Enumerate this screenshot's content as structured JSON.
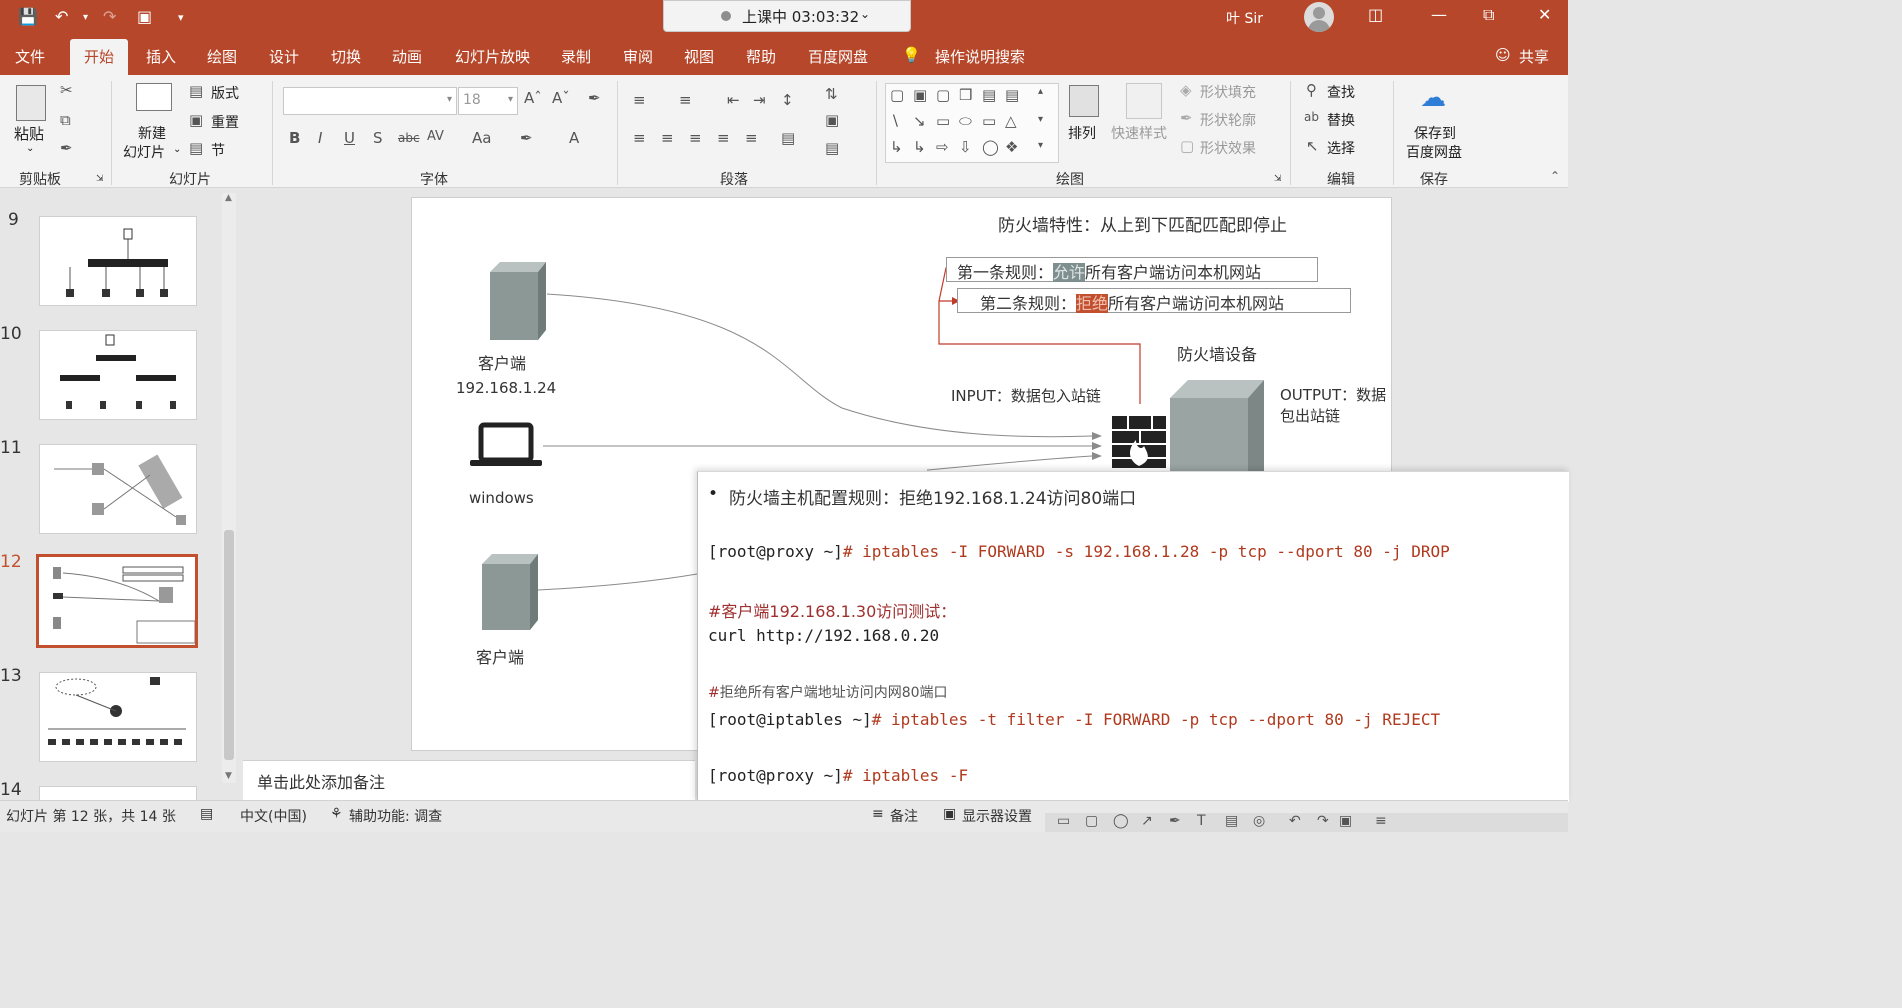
{
  "session": {
    "status": "上课中 03:03:32"
  },
  "user": {
    "name": "叶 Sir"
  },
  "tabs": [
    "文件",
    "开始",
    "插入",
    "绘图",
    "设计",
    "切换",
    "动画",
    "幻灯片放映",
    "录制",
    "审阅",
    "视图",
    "帮助",
    "百度网盘"
  ],
  "active_tab": "开始",
  "search_tab": "操作说明搜索",
  "share": "共享",
  "ribbon": {
    "clipboard": {
      "label": "剪贴板",
      "paste": "粘贴"
    },
    "slides": {
      "label": "幻灯片",
      "new_slide_1": "新建",
      "new_slide_2": "幻灯片",
      "layout": "版式",
      "reset": "重置",
      "section": "节"
    },
    "font": {
      "label": "字体",
      "size": "18"
    },
    "paragraph": {
      "label": "段落"
    },
    "drawing": {
      "label": "绘图",
      "arrange": "排列",
      "quick_styles": "快速样式",
      "shape_fill": "形状填充",
      "shape_outline": "形状轮廓",
      "shape_effects": "形状效果"
    },
    "editing": {
      "label": "编辑",
      "find": "查找",
      "replace": "替换",
      "select": "选择"
    },
    "save": {
      "label": "保存",
      "save_to_1": "保存到",
      "save_to_2": "百度网盘"
    }
  },
  "slide_numbers": [
    "9",
    "10",
    "11",
    "12",
    "13",
    "14"
  ],
  "selected_slide": "12",
  "slide": {
    "title": "防火墙特性：从上到下匹配匹配即停止",
    "rule1_prefix": "第一条规则：",
    "rule1_action": "允许",
    "rule1_suffix": "所有客户端访问本机网站",
    "rule2_prefix": "第二条规则：",
    "rule2_action": "拒绝",
    "rule2_suffix": "所有客户端访问本机网站",
    "firewall_device": "防火墙设备",
    "input_chain": "INPUT：数据包入站链",
    "output_chain": "OUTPUT：数据包出站链",
    "client1_label": "客户端",
    "client1_ip": "192.168.1.24",
    "windows_label": "windows",
    "client2_label": "客户端"
  },
  "terminal": {
    "bullet": "防火墙主机配置规则：拒绝192.168.1.24访问80端口",
    "line1_prompt": "[root@proxy ~]",
    "line1_cmd": "# iptables -I FORWARD -s 192.168.1.28 -p tcp --dport 80 -j DROP",
    "comment1_hash": "#",
    "comment1_text": "客户端192.168.1.30访问测试：",
    "line2": "curl http://192.168.0.20",
    "comment2_hash": "#",
    "comment2_text": "拒绝所有客户端地址访问内网80端口",
    "line3_prompt": "[root@iptables ~]",
    "line3_cmd": "# iptables -t filter -I FORWARD -p tcp --dport 80 -j REJECT",
    "line4_prompt": "[root@proxy ~]",
    "line4_cmd": "# iptables -F"
  },
  "notes": {
    "placeholder": "单击此处添加备注"
  },
  "status": {
    "slide_info": "幻灯片 第 12 张，共 14 张",
    "language": "中文(中国)",
    "accessibility": "辅助功能: 调查",
    "notes": "备注",
    "display_settings": "显示器设置"
  },
  "colors": {
    "accent": "#b7472a",
    "allow_bg": "#7f8f8f",
    "deny_bg": "#c2502f",
    "connector": "#c23b2a"
  }
}
